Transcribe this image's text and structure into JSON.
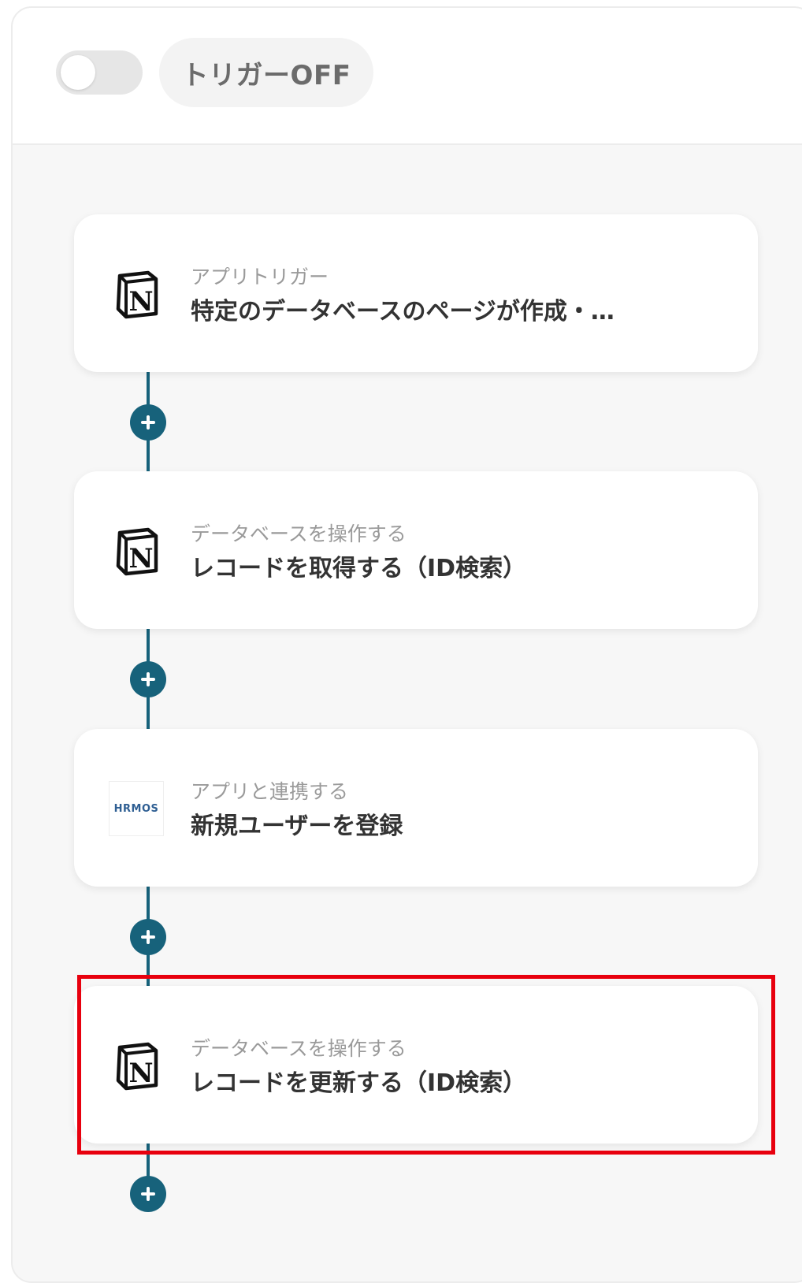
{
  "header": {
    "trigger_label": "トリガーOFF"
  },
  "steps": [
    {
      "subtitle": "アプリトリガー",
      "title": "特定のデータベースのページが作成・…",
      "icon": "notion-icon"
    },
    {
      "subtitle": "データベースを操作する",
      "title": "レコードを取得する（ID検索）",
      "icon": "notion-icon"
    },
    {
      "subtitle": "アプリと連携する",
      "title": "新規ユーザーを登録",
      "icon": "hrmos-icon",
      "icon_text": "HRMOS"
    },
    {
      "subtitle": "データベースを操作する",
      "title": "レコードを更新する（ID検索）",
      "icon": "notion-icon"
    }
  ],
  "colors": {
    "connector": "#17627b",
    "highlight": "#e8000e"
  }
}
